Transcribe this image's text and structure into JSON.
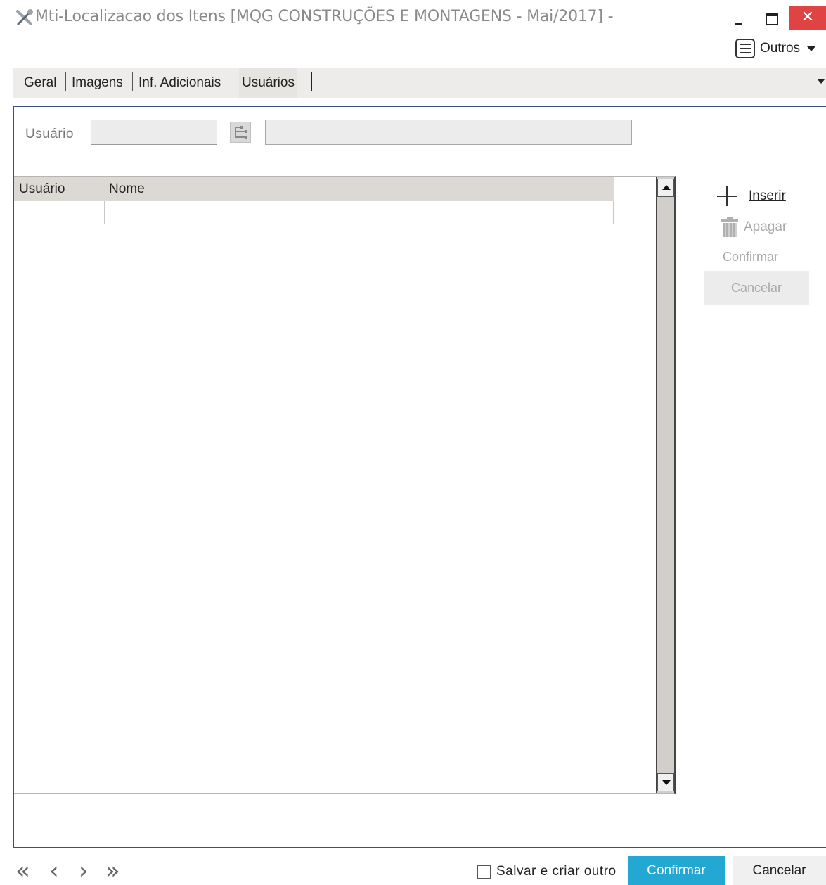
{
  "window": {
    "title": "Mti-Localizacao dos Itens [MQG CONSTRUÇÕES E MONTAGENS - Mai/2017]  -",
    "close_glyph": "✕"
  },
  "toolbar": {
    "outros_label": "Outros"
  },
  "tabs": [
    {
      "label": "Geral"
    },
    {
      "label": "Imagens"
    },
    {
      "label": "Inf. Adicionais"
    },
    {
      "label": "Usuários",
      "active": true
    }
  ],
  "filter": {
    "usuario_label": "Usuário",
    "usuario_value": "",
    "nome_value": ""
  },
  "grid": {
    "columns": [
      "Usuário",
      "Nome"
    ],
    "rows": [
      {
        "usuario": "",
        "nome": ""
      }
    ]
  },
  "side_actions": {
    "inserir": "Inserir",
    "apagar": "Apagar",
    "confirmar": "Confirmar",
    "cancelar": "Cancelar"
  },
  "footer": {
    "nav_first": "«",
    "nav_prev": "‹",
    "nav_next": "›",
    "nav_last": "»",
    "save_and_new": "Salvar e criar outro",
    "confirm": "Confirmar",
    "cancel": "Cancelar"
  },
  "colors": {
    "accent": "#23a8d4",
    "close": "#e04343",
    "panel_border": "#3b4f86"
  },
  "icons": [
    "app-tools-icon",
    "minimize-icon",
    "maximize-icon",
    "close-icon",
    "list-menu-icon",
    "lookup-tree-icon",
    "plus-icon",
    "trash-icon"
  ]
}
